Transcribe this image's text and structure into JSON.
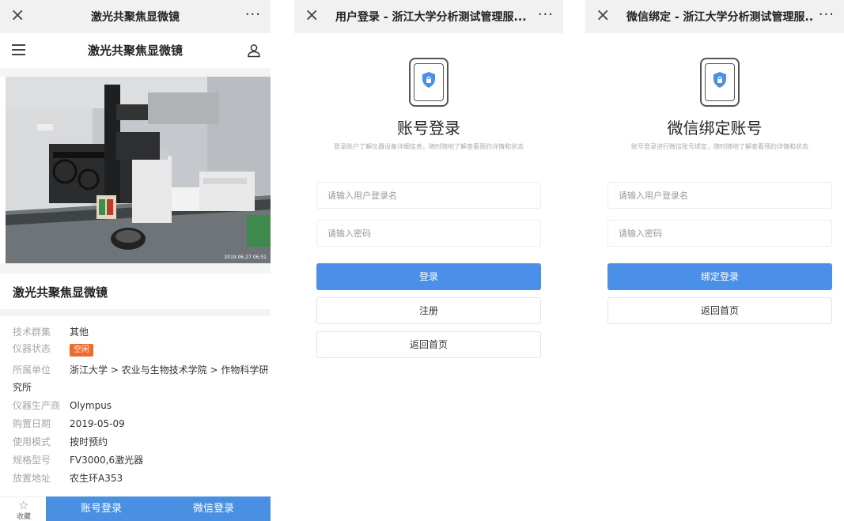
{
  "panel1": {
    "wx_close": "×",
    "wx_title": "激光共聚焦显微镜",
    "wx_more": "···",
    "app_title": "激光共聚焦显微镜",
    "photo_timestamp": "2019.06.27 06:51",
    "instrument_name": "激光共聚焦显微镜",
    "info": [
      {
        "label": "技术群集",
        "value": "其他"
      },
      {
        "label": "仪器状态",
        "value": "空闲"
      },
      {
        "label": "所属单位",
        "value": "浙江大学 > 农业与生物技术学院 > 作物科学研"
      },
      {
        "label": "仪器生产商",
        "value": "Olympus"
      },
      {
        "label": "购置日期",
        "value": "2019-05-09"
      },
      {
        "label": "使用模式",
        "value": "按时预约"
      },
      {
        "label": "规格型号",
        "value": "FV3000,6激光器"
      },
      {
        "label": "放置地址",
        "value": "农生环A353"
      }
    ],
    "unit_wrap": "究所",
    "fav_icon": "☆",
    "fav_label": "收藏",
    "account_login": "账号登录",
    "wechat_login": "微信登录"
  },
  "panel2": {
    "wx_close": "×",
    "wx_title": "用户登录 - 浙江大学分析测试管理服...",
    "wx_more": "···",
    "title": "账号登录",
    "desc": "登录账户了解仪器设备详细信息，随时随地了解查看预约详情和状态",
    "username_placeholder": "请输入用户登录名",
    "password_placeholder": "请输入密码",
    "login": "登录",
    "register": "注册",
    "home": "返回首页"
  },
  "panel3": {
    "wx_close": "×",
    "wx_title": "微信绑定 - 浙江大学分析测试管理服...",
    "wx_more": "···",
    "title": "微信绑定账号",
    "desc": "账号登录进行微信账号绑定，随时随地了解查看预约详情和状态",
    "username_placeholder": "请输入用户登录名",
    "password_placeholder": "请输入密码",
    "bind_login": "绑定登录",
    "home": "返回首页"
  },
  "colors": {
    "primary_blue": "#4a8fe8",
    "status_orange": "#f06a2b"
  },
  "icons": [
    "close-icon",
    "more-icon",
    "menu-icon",
    "user-icon",
    "phone-lock-icon",
    "shield-lock-icon",
    "star-icon"
  ]
}
